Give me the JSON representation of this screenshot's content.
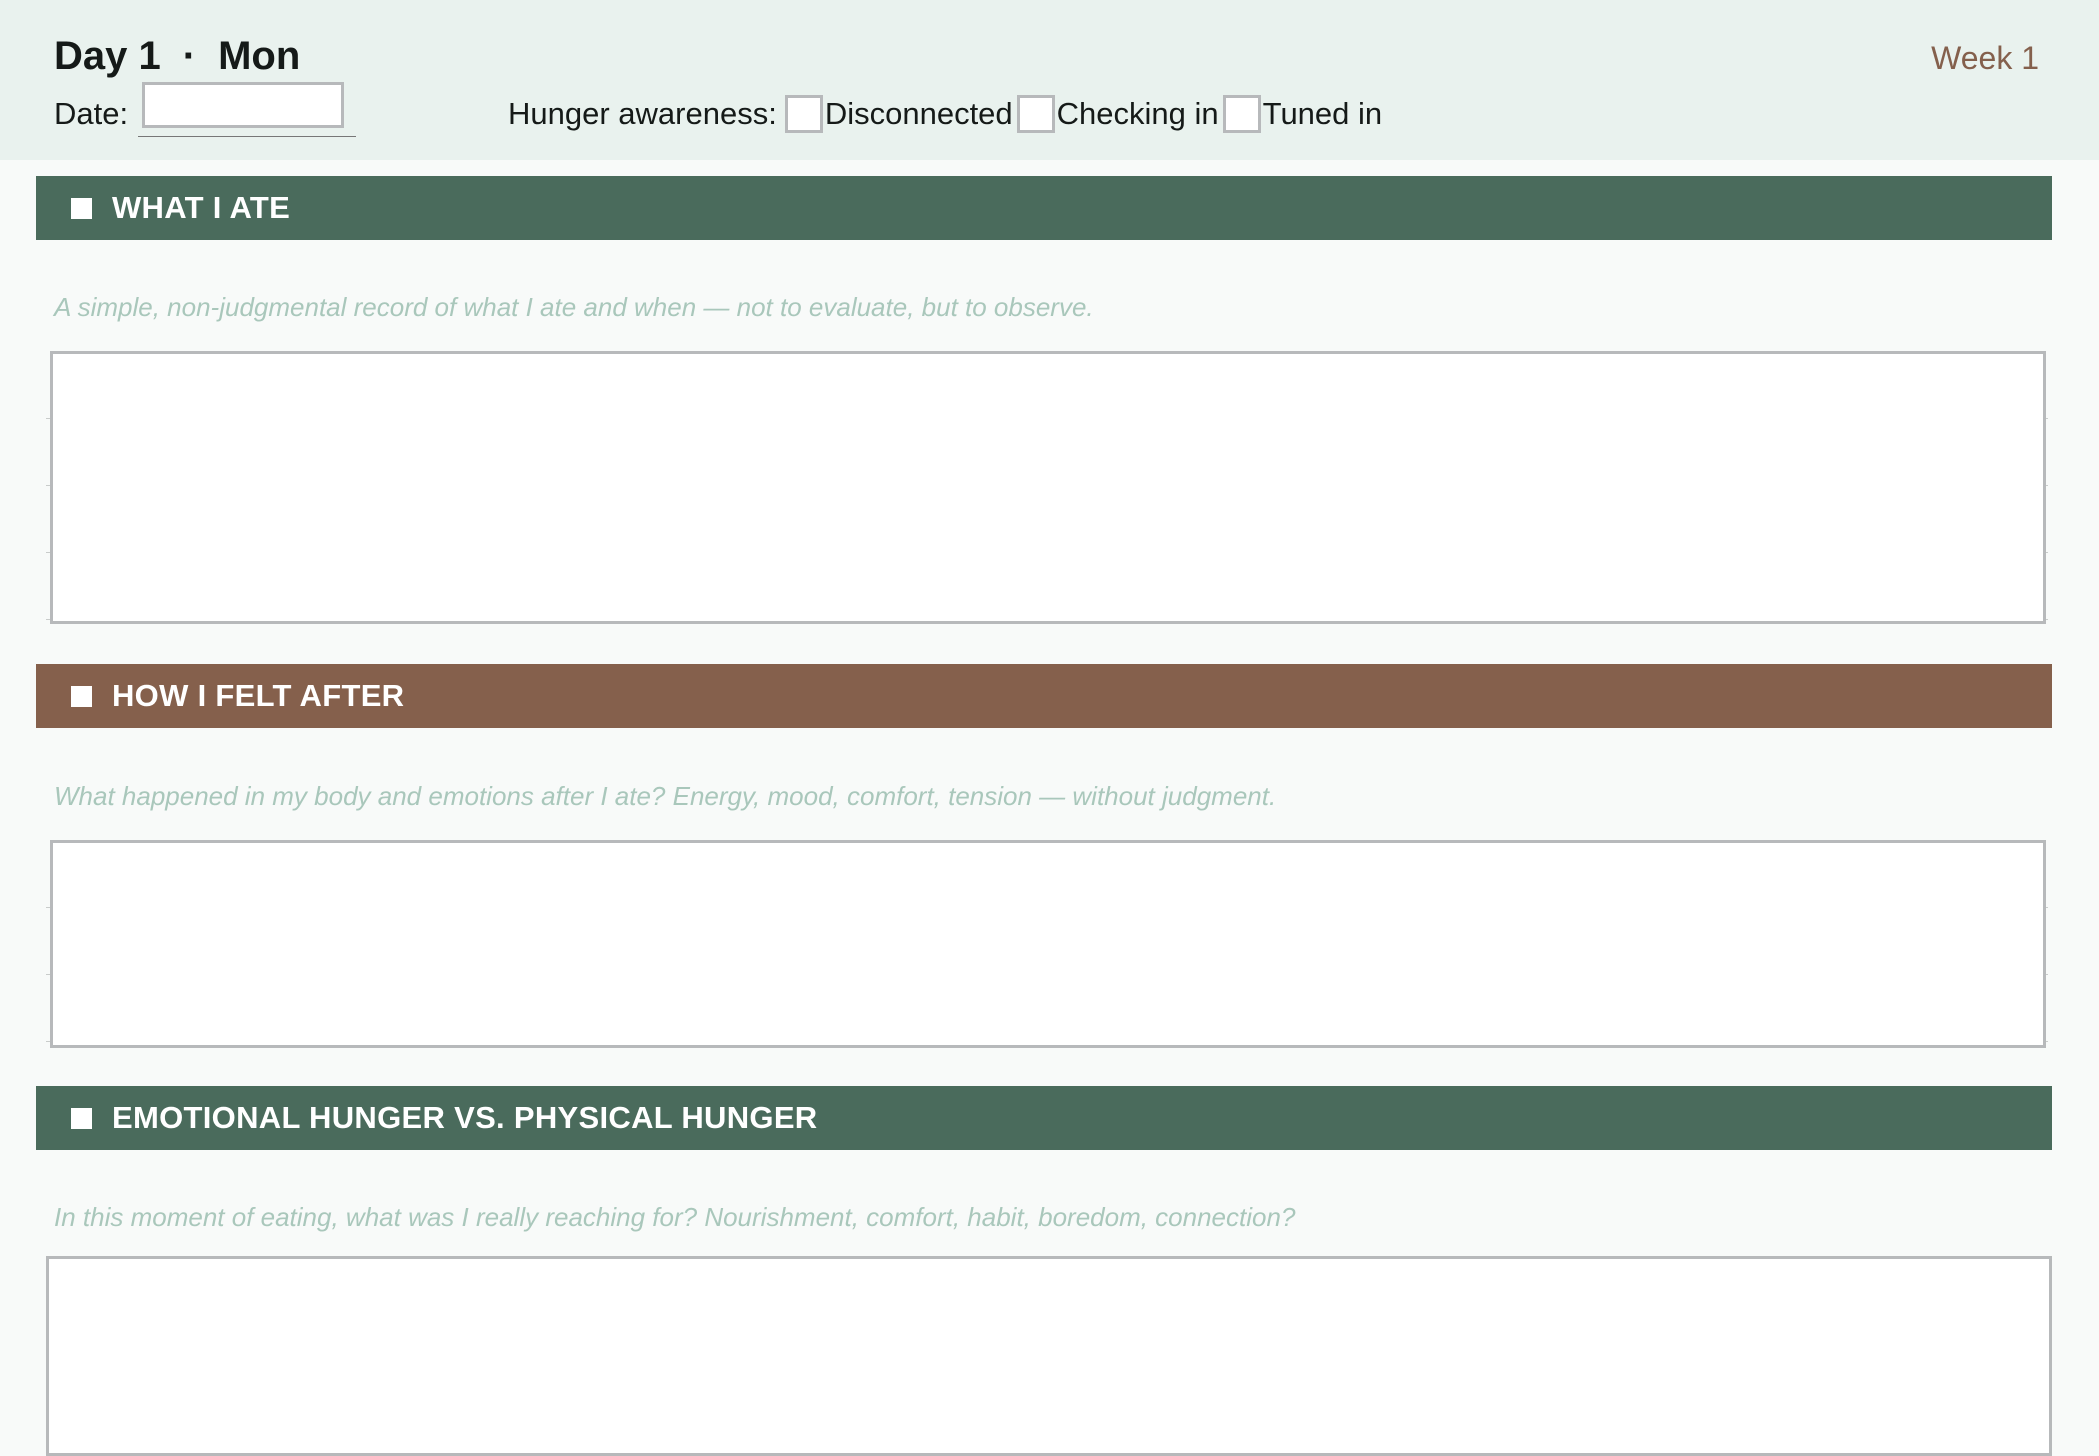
{
  "header": {
    "day": "Day 1",
    "separator": "·",
    "weekday": "Mon",
    "week": "Week 1",
    "date_label": "Date:",
    "date_value": "",
    "hunger_label": "Hunger awareness:",
    "hunger_options": [
      {
        "label": "Disconnected",
        "checked": false
      },
      {
        "label": "Checking in",
        "checked": false
      },
      {
        "label": "Tuned in",
        "checked": false
      }
    ]
  },
  "sections": [
    {
      "title": "WHAT I ATE",
      "prompt": "A simple, non-judgmental record of what I ate and when — not to evaluate, but to observe.",
      "response": "",
      "color": "#4a6b5c"
    },
    {
      "title": "HOW I FELT AFTER",
      "prompt": "What happened in my body and emotions after I ate? Energy, mood, comfort, tension — without judgment.",
      "response": "",
      "color": "#85604c"
    },
    {
      "title": "EMOTIONAL HUNGER VS. PHYSICAL HUNGER",
      "prompt": "In this moment of eating, what was I really reaching for? Nourishment, comfort, habit, boredom, connection?",
      "response": "",
      "color": "#4a6b5c"
    }
  ],
  "colors": {
    "header_bg": "#e9f2ee",
    "page_bg": "#f8faf9",
    "accent_green": "#4a6b5c",
    "accent_brown": "#85604c",
    "prompt_text": "#a9c7bb",
    "week_text": "#84604c"
  },
  "icons": {
    "section_marker": "square-bullet-icon"
  }
}
